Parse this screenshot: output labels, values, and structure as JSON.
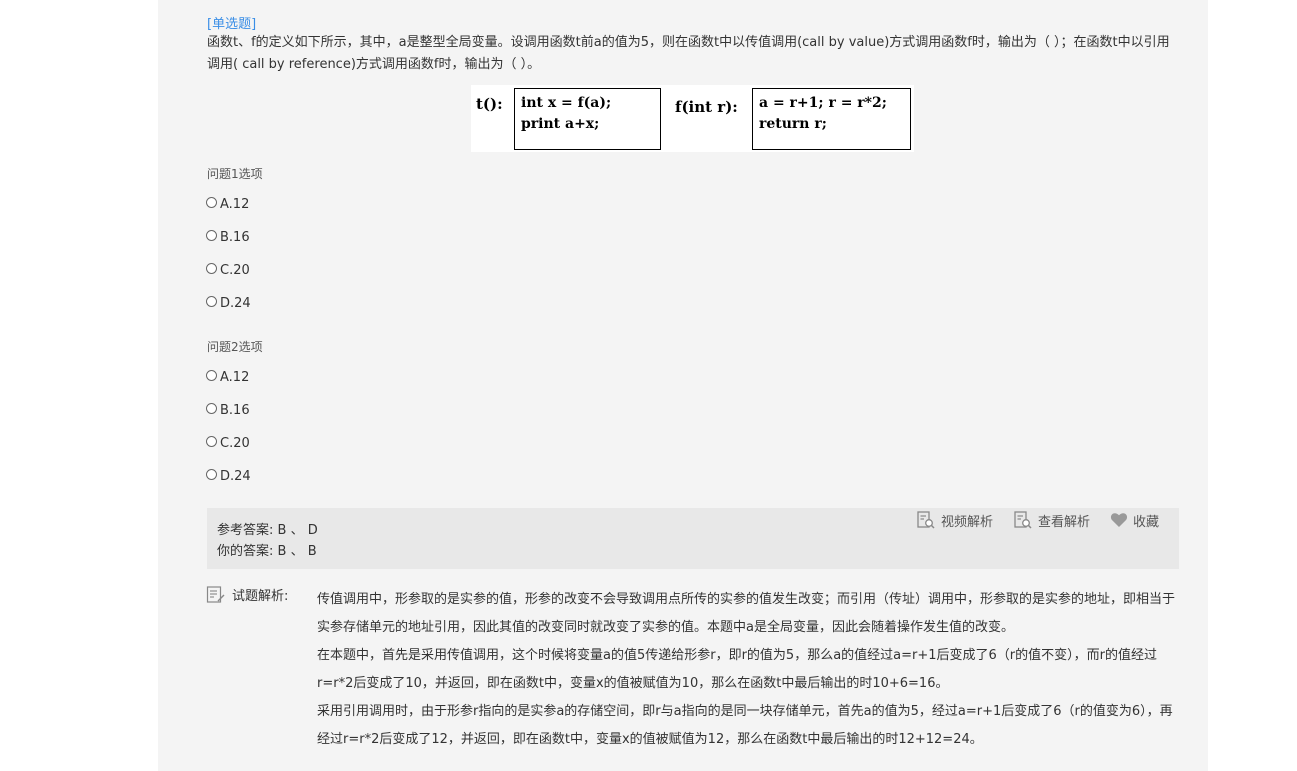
{
  "question": {
    "type_tag": "[单选题]",
    "stem": "函数t、f的定义如下所示，其中，a是整型全局变量。设调用函数t前a的值为5，则在函数t中以传值调用(call by value)方式调用函数f时，输出为（  ）；在函数t中以引用调用( call by reference)方式调用函数f时，输出为（  ）。"
  },
  "code_figure": {
    "t_label": "t():",
    "t_line1": "int x = f(a);",
    "t_line2": "print a+x;",
    "f_label": "f(int r):",
    "f_line1": "a = r+1; r = r*2;",
    "f_line2": "return r;"
  },
  "q1": {
    "label": "问题1选项",
    "options": [
      "A.12",
      "B.16",
      "C.20",
      "D.24"
    ]
  },
  "q2": {
    "label": "问题2选项",
    "options": [
      "A.12",
      "B.16",
      "C.20",
      "D.24"
    ]
  },
  "answer": {
    "reference": "参考答案:   B  、 D",
    "yours": "你的答案:   B  、 B",
    "video_label": "视频解析",
    "view_label": "查看解析",
    "fav_label": "收藏"
  },
  "analysis": {
    "heading": "试题解析:",
    "p1": "传值调用中，形参取的是实参的值，形参的改变不会导致调用点所传的实参的值发生改变；而引用（传址）调用中，形参取的是实参的地址，即相当于实参存储单元的地址引用，因此其值的改变同时就改变了实参的值。本题中a是全局变量，因此会随着操作发生值的改变。",
    "p2": "在本题中，首先是采用传值调用，这个时候将变量a的值5传递给形参r，即r的值为5，那么a的值经过a=r+1后变成了6（r的值不变），而r的值经过r=r*2后变成了10，并返回，即在函数t中，变量x的值被赋值为10，那么在函数t中最后输出的时10+6=16。",
    "p3": "采用引用调用时，由于形参r指向的是实参a的存储空间，即r与a指向的是同一块存储单元，首先a的值为5，经过a=r+1后变成了6（r的值变为6），再经过r=r*2后变成了12，并返回，即在函数t中，变量x的值被赋值为12，那么在函数t中最后输出的时12+12=24。"
  },
  "colors": {
    "tag": "#3a8ee6",
    "panel": "#f4f4f4",
    "answer_box": "#e8e8e8"
  }
}
